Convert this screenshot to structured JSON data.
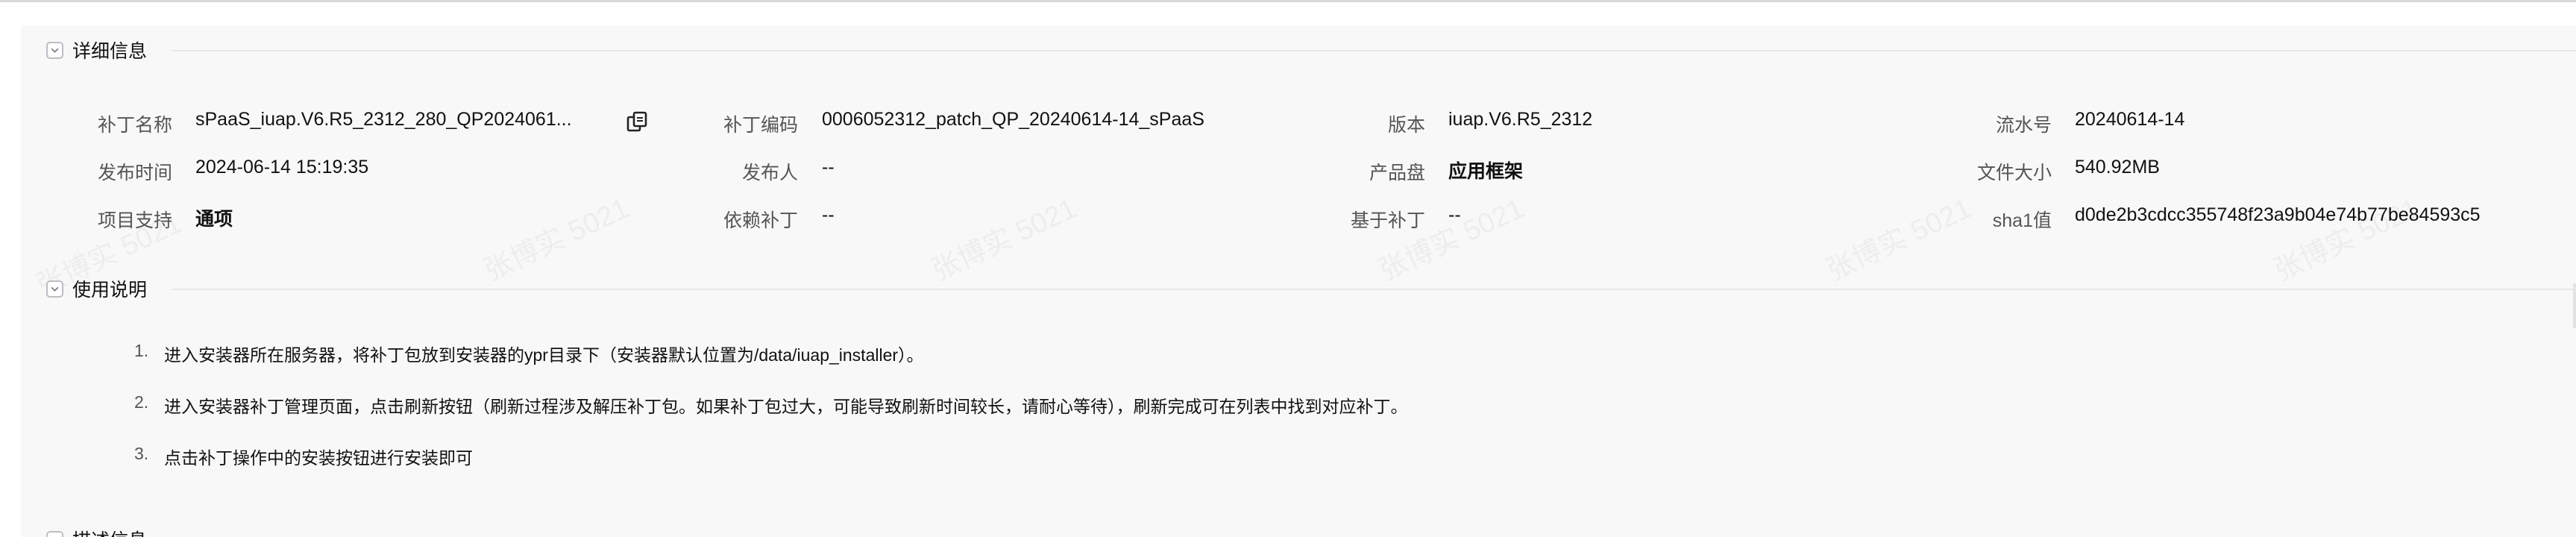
{
  "sections": {
    "details_title": "详细信息",
    "usage_title": "使用说明",
    "description_title": "描述信息"
  },
  "details": {
    "patch_name_label": "补丁名称",
    "patch_name_value": "sPaaS_iuap.V6.R5_2312_280_QP2024061...",
    "patch_code_label": "补丁编码",
    "patch_code_value": "0006052312_patch_QP_20240614-14_sPaaS",
    "version_label": "版本",
    "version_value": "iuap.V6.R5_2312",
    "serial_label": "流水号",
    "serial_value": "20240614-14",
    "publish_time_label": "发布时间",
    "publish_time_value": "2024-06-14 15:19:35",
    "publisher_label": "发布人",
    "publisher_value": "--",
    "product_disk_label": "产品盘",
    "product_disk_value": "应用框架",
    "file_size_label": "文件大小",
    "file_size_value": "540.92MB",
    "project_support_label": "项目支持",
    "project_support_value": "通项",
    "depends_label": "依赖补丁",
    "depends_value": "--",
    "base_patch_label": "基于补丁",
    "base_patch_value": "--",
    "sha1_label": "sha1值",
    "sha1_value": "d0de2b3cdcc355748f23a9b04e74b77be84593c5"
  },
  "usage": {
    "steps": [
      {
        "num": "1.",
        "text": "进入安装器所在服务器，将补丁包放到安装器的ypr目录下（安装器默认位置为/data/iuap_installer）。"
      },
      {
        "num": "2.",
        "text": "进入安装器补丁管理页面，点击刷新按钮（刷新过程涉及解压补丁包。如果补丁包过大，可能导致刷新时间较长，请耐心等待），刷新完成可在列表中找到对应补丁。"
      },
      {
        "num": "3.",
        "text": "点击补丁操作中的安装按钮进行安装即可"
      }
    ]
  },
  "watermark": "张博实 5021",
  "icons": {
    "collapse": "chevron-down-icon",
    "copy": "copy-icon"
  },
  "colors": {
    "panel_bg": "#f8f8f9",
    "label": "#555555",
    "value": "#111111"
  }
}
